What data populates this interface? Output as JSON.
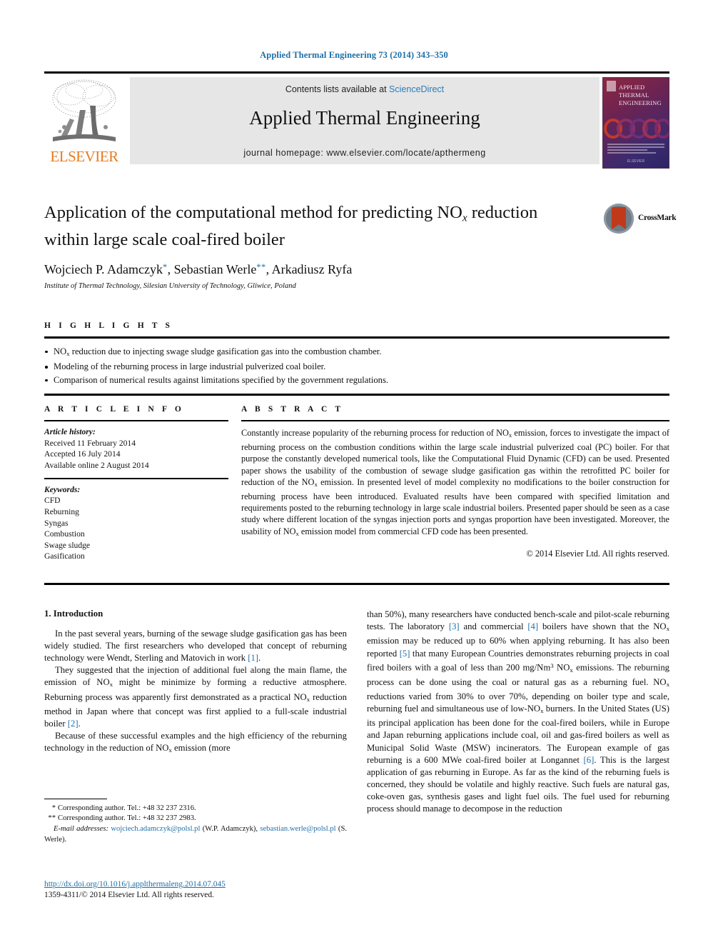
{
  "running_head": "Applied Thermal Engineering 73 (2014) 343–350",
  "masthead": {
    "contents_prefix": "Contents lists available at ",
    "sciencedirect": "ScienceDirect",
    "journal_name": "Applied Thermal Engineering",
    "homepage": "journal homepage: www.elsevier.com/locate/apthermeng",
    "publisher_wordmark": "ELSEVIER",
    "cover": {
      "line1": "APPLIED",
      "line2": "THERMAL",
      "line3": "ENGINEERING",
      "footer": "ELSEVIER"
    }
  },
  "title": {
    "line1_a": "Application of the computational method for predicting NO",
    "line1_sub": "x",
    "line1_b": " reduction",
    "line2": "within large scale coal-fired boiler",
    "crossmark_label": "CrossMark"
  },
  "authors": {
    "a1": "Wojciech P. Adamczyk",
    "a1_mark": "*",
    "sep1": ", ",
    "a2": "Sebastian Werle",
    "a2_mark": "**",
    "sep2": ", ",
    "a3": "Arkadiusz Ryfa",
    "affiliation": "Institute of Thermal Technology, Silesian University of Technology, Gliwice, Poland"
  },
  "highlights": {
    "label": "H I G H L I G H T S",
    "items": [
      {
        "pre": "NO",
        "sub": "x",
        "post": " reduction due to injecting swage sludge gasification gas into the combustion chamber."
      },
      {
        "pre": "Modeling of the reburning process in large industrial pulverized coal boiler.",
        "sub": "",
        "post": ""
      },
      {
        "pre": "Comparison of numerical results against limitations specified by the government regulations.",
        "sub": "",
        "post": ""
      }
    ]
  },
  "article_info": {
    "label": "A R T I C L E    I N F O",
    "history_label": "Article history:",
    "history": [
      "Received 11 February 2014",
      "Accepted 16 July 2014",
      "Available online 2 August 2014"
    ],
    "keywords_label": "Keywords:",
    "keywords": [
      "CFD",
      "Reburning",
      "Syngas",
      "Combustion",
      "Swage sludge",
      "Gasification"
    ]
  },
  "abstract": {
    "label": "A B S T R A C T",
    "p1": "Constantly increase popularity of the reburning process for reduction of NO",
    "p1_sub": "x",
    "p2": " emission, forces to investigate the impact of reburning process on the combustion conditions within the large scale industrial pulverized coal (PC) boiler. For that purpose the constantly developed numerical tools, like the Computational Fluid Dynamic (CFD) can be used. Presented paper shows the usability of the combustion of sewage sludge gasification gas within the retrofitted PC boiler for reduction of the NO",
    "p2_sub": "x",
    "p3": " emission. In presented level of model complexity no modifications to the boiler construction for reburning process have been introduced. Evaluated results have been compared with specified limitation and requirements posted to the reburning technology in large scale industrial boilers. Presented paper should be seen as a case study where different location of the syngas injection ports and syngas proportion have been investigated. Moreover, the usability of NO",
    "p3_sub": "x",
    "p4": " emission model from commercial CFD code has been presented.",
    "copyright": "© 2014 Elsevier Ltd. All rights reserved."
  },
  "body": {
    "section_heading": "1. Introduction",
    "left": {
      "para1_a": "In the past several years, burning of the sewage sludge gasification gas has been widely studied. The first researchers who developed that concept of reburning technology were Wendt, Sterling and Matovich in work ",
      "para1_ref": "[1]",
      "para1_b": ".",
      "para2_a": "They suggested that the injection of additional fuel along the main flame, the emission of NO",
      "para2_sub1": "x",
      "para2_b": " might be minimize by forming a reductive atmosphere. Reburning process was apparently first demonstrated as a practical NO",
      "para2_sub2": "x",
      "para2_c": " reduction method in Japan where that concept was first applied to a full-scale industrial boiler ",
      "para2_ref": "[2]",
      "para2_d": ".",
      "para3_a": "Because of these successful examples and the high efficiency of the reburning technology in the reduction of NO",
      "para3_sub": "x",
      "para3_b": " emission (more"
    },
    "right": {
      "t1": "than 50%), many researchers have conducted bench-scale and pilot-scale reburning tests. The laboratory ",
      "r1": "[3]",
      "t2": " and commercial ",
      "r2": "[4]",
      "t3": " boilers have shown that the NO",
      "s1": "x",
      "t4": " emission may be reduced up to 60% when applying reburning. It has also been reported ",
      "r3": "[5]",
      "t5": " that many European Countries demonstrates reburning projects in coal fired boilers with a goal of less than 200 mg/Nm",
      "sup1": "3",
      "t6": " NO",
      "s2": "x",
      "t7": " emissions. The reburning process can be done using the coal or natural gas as a reburning fuel. NO",
      "s3": "x",
      "t8": " reductions varied from 30% to over 70%, depending on boiler type and scale, reburning fuel and simultaneous use of low-NO",
      "s4": "x",
      "t9": " burners. In the United States (US) its principal application has been done for the coal-fired boilers, while in Europe and Japan reburning applications include coal, oil and gas-fired boilers as well as Municipal Solid Waste (MSW) incinerators. The European example of gas reburning is a 600 MWe coal-fired boiler at Longannet ",
      "r4": "[6]",
      "t10": ". This is the largest application of gas reburning in Europe. As far as the kind of the reburning fuels is concerned, they should be volatile and highly reactive. Such fuels are natural gas, coke-oven gas, synthesis gases and light fuel oils. The fuel used for reburning process should manage to decompose in the reduction"
    }
  },
  "footnotes": {
    "corr1_mark": "*",
    "corr1": "Corresponding author. Tel.: +48 32 237 2316.",
    "corr2_mark": "**",
    "corr2": "Corresponding author. Tel.: +48 32 237 2983.",
    "email_label": "E-mail addresses:",
    "email1": "wojciech.adamczyk@polsl.pl",
    "email1_owner": " (W.P. Adamczyk), ",
    "email2": "sebastian.werle@polsl.pl",
    "email2_owner": " (S. Werle)."
  },
  "doi": {
    "link": "http://dx.doi.org/10.1016/j.applthermaleng.2014.07.045",
    "issn": "1359-4311/© 2014 Elsevier Ltd. All rights reserved."
  },
  "colors": {
    "link_blue": "#1F6FA8",
    "sciencedirect_blue": "#2B7CB9",
    "elsevier_orange": "#E87B1E",
    "panel_grey": "#E6E6E6"
  }
}
